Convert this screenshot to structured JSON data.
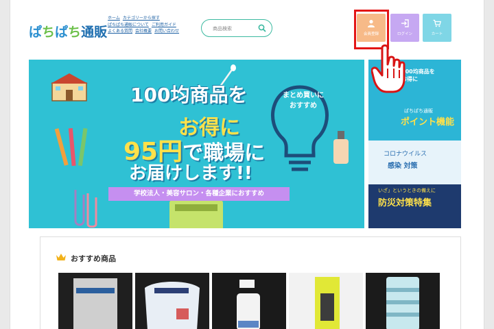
{
  "header": {
    "logo_parts": [
      "ぱ",
      "ち",
      "ぱ",
      "ち",
      "通販"
    ],
    "nav_rows": [
      [
        "ホーム",
        "カテゴリーから探す"
      ],
      [
        "ぱちぱち通販について",
        "ご利用ガイド"
      ],
      [
        "よくある質問",
        "会社概要",
        "お問い合わせ"
      ]
    ],
    "search_placeholder": "商品検索",
    "buttons": {
      "register": "会員登録",
      "login": "ログイン",
      "cart": "カート"
    }
  },
  "banner": {
    "line1": "100均商品を",
    "line2": "お得に",
    "line3_big": "95円",
    "line3_small": "で職場に",
    "line4": "お届けします!!",
    "callout_1": "まとめ買いに",
    "callout_2": "おすすめ",
    "strip": "学校法人・美容サロン・各種企業におすすめ"
  },
  "side_banner": {
    "top_1": "100均商品を",
    "top_2": "お得に",
    "top_3": "ぱちぱち通販",
    "top_4": "ポイント機能",
    "mid_1": "コロナウイルス",
    "mid_2": "感染 対策",
    "bot_1": "いざ」というときの備えに",
    "bot_2": "防災対策特集"
  },
  "recommended": {
    "title": "おすすめ商品",
    "products": [
      {
        "color": "#cfcfcf",
        "label": "ウイルス対策"
      },
      {
        "color": "#e8eef5",
        "label": "Face Shield"
      },
      {
        "color": "#f3f3f3",
        "label": "ガラス"
      },
      {
        "color": "#e1e836",
        "label": ""
      },
      {
        "color": "#c7e8ee",
        "label": "WET TISSUE"
      }
    ]
  },
  "colors": {
    "accent": "#3bb9a0",
    "register": "#f7ba88",
    "login": "#c6a8f2",
    "cart": "#7fd6e6",
    "banner": "#2fc1d4",
    "highlight": "#e31515"
  }
}
